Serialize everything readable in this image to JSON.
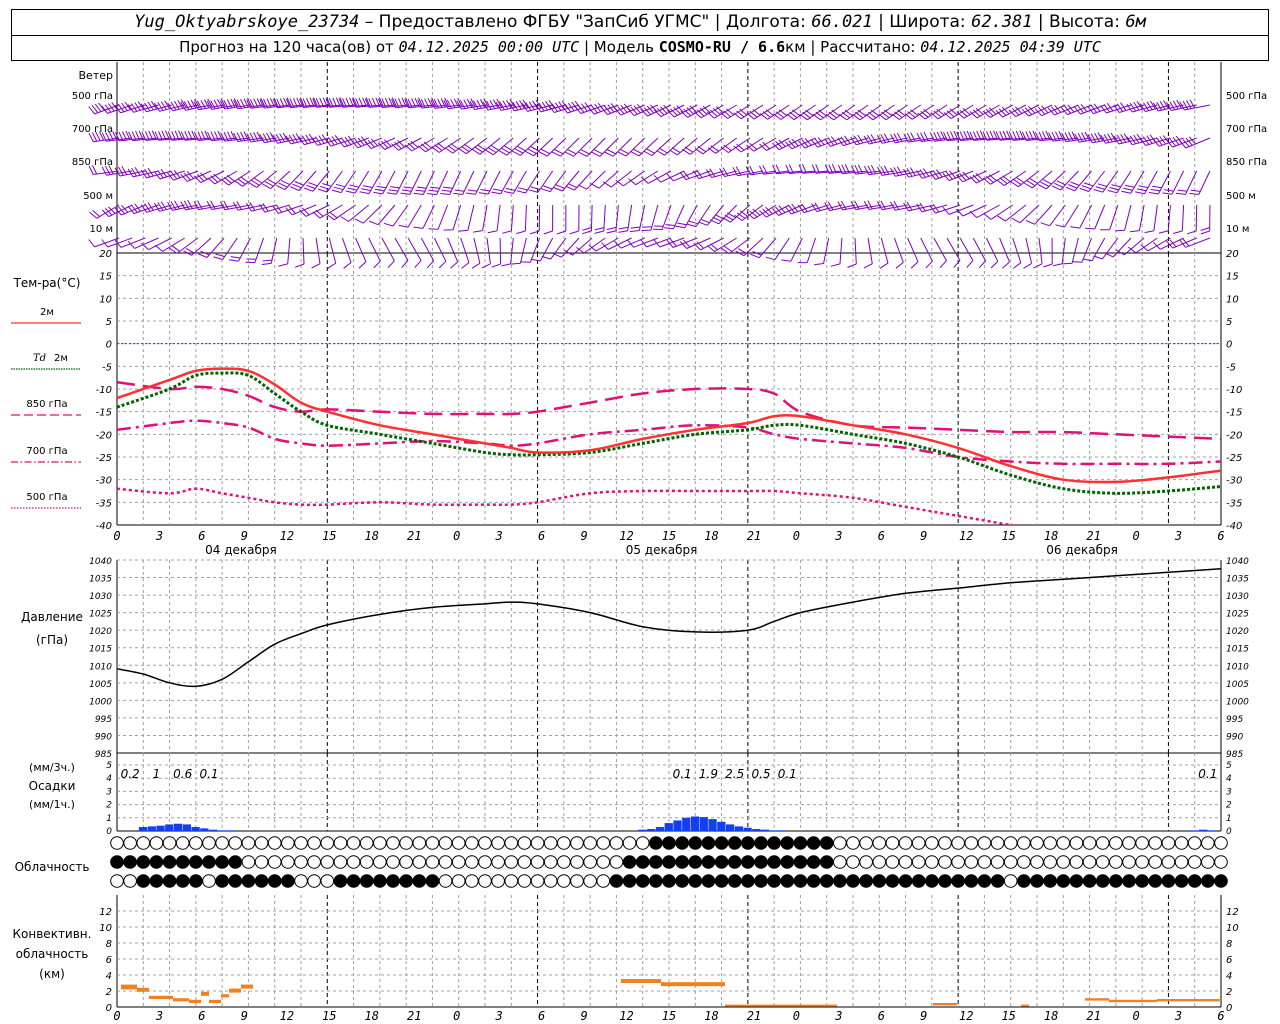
{
  "header": {
    "station": "Yug_Oktyabrskoye_23734",
    "provided_by": "– Предоставлено ФГБУ \"ЗапСиб УГМС\"",
    "longitude_label": "| Долгота:",
    "longitude": "66.021",
    "latitude_label": "| Широта:",
    "latitude": "62.381",
    "altitude_label": "| Высота:",
    "altitude": "6м",
    "forecast_label": "Прогноз на 120 часа(ов) от",
    "forecast_start": "04.12.2025 00:00 UTC",
    "model_label": "| Модель",
    "model": "COSMO-RU / 6.6",
    "model_unit": "км",
    "computed_label": "| Рассчитано:",
    "computed_at": "04.12.2025 04:39 UTC"
  },
  "axes": {
    "hour_ticks": [
      "0",
      "3",
      "6",
      "9",
      "12",
      "15",
      "18",
      "21",
      "0",
      "3",
      "6",
      "9",
      "12",
      "15",
      "18",
      "21",
      "0",
      "3",
      "6",
      "9",
      "12",
      "15",
      "18",
      "21",
      "0",
      "3",
      "6"
    ],
    "day_labels": [
      "04 декабря",
      "05 декабря",
      "06 декабря"
    ]
  },
  "labels": {
    "wind": "Ветер",
    "wind_levels": [
      "500 гПа",
      "700 гПа",
      "850 гПа",
      "500 м",
      "10   м"
    ],
    "temp_title": "Тем-ра(°C)",
    "legend_2m": "2м",
    "legend_td": "Td",
    "legend_td_2m": "2м",
    "legend_850": "850 гПа",
    "legend_700": "700 гПа",
    "legend_500": "500 гПа",
    "pressure_title": "Давление",
    "pressure_unit": "(гПа)",
    "precip_unit3": "(мм/3ч.)",
    "precip_title": "Осадки",
    "precip_unit1": "(мм/1ч.)",
    "cloud_title": "Облачность",
    "conv_title1": "Конвективн.",
    "conv_title2": "облачность",
    "conv_unit": "(км)"
  },
  "colors": {
    "t2m": "#ff3030",
    "td2m": "#006400",
    "t850": "#e0107a",
    "t700": "#e0107a",
    "t500": "#e0107a",
    "wind": "#8000c0",
    "pressure": "#000000",
    "precip": "#1040f0",
    "convective": "#f08020",
    "grid": "#a0a0a0"
  },
  "chart_data": [
    {
      "type": "line",
      "name": "temperature",
      "ylim": [
        -40,
        20
      ],
      "yticks": [
        20,
        15,
        10,
        5,
        0,
        -5,
        -10,
        -15,
        -20,
        -25,
        -30,
        -35,
        -40
      ],
      "x_hours": [
        0,
        6,
        9,
        12,
        15,
        18,
        21,
        24,
        30,
        36,
        42,
        45,
        48,
        54,
        60,
        66,
        72,
        75,
        78,
        84,
        90,
        96,
        102,
        108,
        114,
        120,
        126
      ],
      "series": [
        {
          "name": "2м",
          "values": [
            -12,
            -8,
            -6,
            -5.5,
            -6,
            -9,
            -13,
            -15,
            -18,
            -20,
            -22,
            -23,
            -24,
            -23.5,
            -21,
            -19,
            -17.5,
            -16,
            -16,
            -18,
            -20,
            -23,
            -27,
            -30,
            -30.5,
            -29.5,
            -28
          ]
        },
        {
          "name": "Td 2м",
          "values": [
            -14,
            -10,
            -7,
            -6.5,
            -7,
            -11,
            -15,
            -18,
            -20,
            -22,
            -24,
            -24.5,
            -24.5,
            -24,
            -22,
            -20,
            -19,
            -18,
            -18,
            -20,
            -22,
            -25,
            -29,
            -32,
            -33,
            -32.5,
            -31.5
          ]
        },
        {
          "name": "850 гПа",
          "values": [
            -8.5,
            -10,
            -9.5,
            -10,
            -11.5,
            -14,
            -15,
            -14.5,
            -15,
            -15.5,
            -15.5,
            -15.5,
            -15,
            -13,
            -11,
            -10,
            -10,
            -11,
            -15,
            -18,
            -18.5,
            -19,
            -19.5,
            -19.5,
            -20,
            -20.5,
            -21
          ]
        },
        {
          "name": "700 гПа",
          "values": [
            -19,
            -17.5,
            -17,
            -17.5,
            -18.5,
            -21,
            -22,
            -22.5,
            -22,
            -21.5,
            -22,
            -22.5,
            -22,
            -20,
            -19,
            -18,
            -18.5,
            -20,
            -21,
            -22,
            -23,
            -25,
            -26,
            -26.5,
            -26.5,
            -26.5,
            -26
          ]
        },
        {
          "name": "500 гПа",
          "values": [
            -32,
            -33,
            -32,
            -33,
            -34,
            -35,
            -35.5,
            -35.5,
            -35,
            -35.5,
            -35.5,
            -35.5,
            -35,
            -33,
            -32.5,
            -32.5,
            -32.5,
            -32.5,
            -33,
            -34,
            -36,
            -38,
            -40,
            -42,
            -44,
            -46,
            -48
          ]
        }
      ]
    },
    {
      "type": "line",
      "name": "pressure",
      "ylim": [
        985,
        1040
      ],
      "yticks": [
        1040,
        1035,
        1030,
        1025,
        1020,
        1015,
        1010,
        1005,
        1000,
        995,
        990,
        985
      ],
      "x_hours": [
        0,
        3,
        6,
        9,
        12,
        15,
        18,
        21,
        24,
        30,
        36,
        42,
        45,
        48,
        54,
        60,
        66,
        72,
        75,
        78,
        84,
        90,
        96,
        102,
        108,
        114,
        120,
        126
      ],
      "values": [
        1009,
        1007.5,
        1005,
        1004,
        1006,
        1011,
        1016,
        1019,
        1021.5,
        1024.5,
        1026.5,
        1027.5,
        1028,
        1027.5,
        1025,
        1021,
        1019.5,
        1020,
        1022.5,
        1025,
        1028,
        1030.5,
        1032,
        1033.5,
        1034.5,
        1035.5,
        1036.5,
        1037.5
      ]
    },
    {
      "type": "bar",
      "name": "precipitation",
      "ylim": [
        0,
        5
      ],
      "yticks": [
        5,
        4,
        3,
        2,
        1,
        0
      ],
      "x_hours": [
        3,
        4,
        5,
        6,
        7,
        8,
        9,
        10,
        11,
        12,
        13,
        60,
        61,
        62,
        63,
        64,
        65,
        66,
        67,
        68,
        69,
        70,
        71,
        72,
        73,
        74,
        75,
        76,
        123,
        124,
        125
      ],
      "values": [
        0.3,
        0.35,
        0.4,
        0.5,
        0.55,
        0.5,
        0.3,
        0.2,
        0.1,
        0.05,
        0.05,
        0.1,
        0.15,
        0.3,
        0.6,
        0.8,
        1.0,
        1.1,
        1.05,
        0.9,
        0.7,
        0.5,
        0.35,
        0.25,
        0.15,
        0.1,
        0.05,
        0.05,
        0.05,
        0.1,
        0.05
      ],
      "totals_3h": [
        {
          "hour": 1.5,
          "value": "0.2"
        },
        {
          "hour": 4.5,
          "value": "1"
        },
        {
          "hour": 7.5,
          "value": "0.6"
        },
        {
          "hour": 10.5,
          "value": "0.1"
        },
        {
          "hour": 64.5,
          "value": "0.1"
        },
        {
          "hour": 67.5,
          "value": "1.9"
        },
        {
          "hour": 70.5,
          "value": "2.5"
        },
        {
          "hour": 73.5,
          "value": "0.5"
        },
        {
          "hour": 76.5,
          "value": "0.1"
        },
        {
          "hour": 124.5,
          "value": "0.1"
        }
      ]
    },
    {
      "type": "table",
      "name": "cloudiness",
      "rows": [
        "high",
        "middle",
        "low"
      ],
      "x_hours_step": 1.5,
      "high_full_ranges": [
        [
          61,
          82
        ]
      ],
      "middle_full_ranges": [
        [
          0,
          14
        ],
        [
          58,
          81
        ]
      ],
      "low_full_ranges": [
        [
          2,
          9
        ],
        [
          11,
          20
        ],
        [
          25,
          36
        ],
        [
          56,
          101
        ],
        [
          103,
          126
        ]
      ]
    },
    {
      "type": "bar",
      "name": "convective",
      "ylim": [
        0,
        14
      ],
      "yticks": [
        12,
        10,
        8,
        6,
        4,
        2,
        0
      ],
      "segments": [
        {
          "from": 0.5,
          "to": 2.5,
          "base": 2.2,
          "top": 2.8
        },
        {
          "from": 2.5,
          "to": 4,
          "base": 1.9,
          "top": 2.4
        },
        {
          "from": 4,
          "to": 7,
          "base": 1.0,
          "top": 1.4
        },
        {
          "from": 7,
          "to": 9,
          "base": 0.7,
          "top": 1.1
        },
        {
          "from": 9,
          "to": 10.5,
          "base": 0.5,
          "top": 0.9
        },
        {
          "from": 10.5,
          "to": 11.5,
          "base": 1.4,
          "top": 1.9
        },
        {
          "from": 11.5,
          "to": 13,
          "base": 0.5,
          "top": 0.9
        },
        {
          "from": 13,
          "to": 14,
          "base": 1.2,
          "top": 1.6
        },
        {
          "from": 14,
          "to": 15.5,
          "base": 1.8,
          "top": 2.3
        },
        {
          "from": 15.5,
          "to": 17,
          "base": 2.3,
          "top": 2.8
        },
        {
          "from": 63,
          "to": 68,
          "base": 3.0,
          "top": 3.5
        },
        {
          "from": 68,
          "to": 76,
          "base": 2.6,
          "top": 3.1
        },
        {
          "from": 76,
          "to": 90,
          "base": 0.1,
          "top": 0.3
        },
        {
          "from": 102,
          "to": 105,
          "base": 0.2,
          "top": 0.5
        },
        {
          "from": 113,
          "to": 114,
          "base": 0.1,
          "top": 0.3
        },
        {
          "from": 121,
          "to": 124,
          "base": 0.8,
          "top": 1.1
        },
        {
          "from": 124,
          "to": 130,
          "base": 0.6,
          "top": 0.9
        },
        {
          "from": 130,
          "to": 138,
          "base": 0.7,
          "top": 1.0
        }
      ]
    }
  ]
}
